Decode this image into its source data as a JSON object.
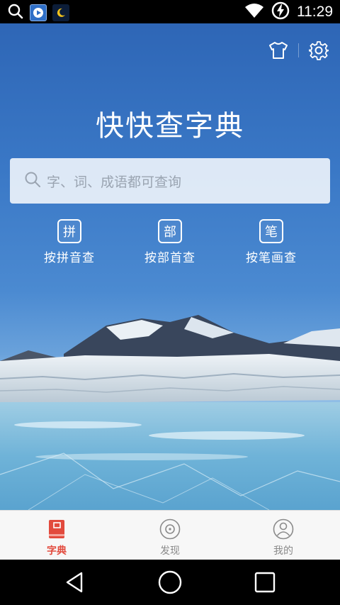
{
  "status_bar": {
    "time": "11:29",
    "left_icons": [
      "search-icon",
      "video-player-app-icon",
      "night-mode-app-icon"
    ],
    "right_icons": [
      "wifi-icon",
      "battery-charging-icon"
    ]
  },
  "header": {
    "app_title": "快快查字典",
    "icons": [
      "shirt-icon",
      "gear-icon"
    ]
  },
  "search": {
    "placeholder": "字、词、成语都可查询"
  },
  "lookup_modes": [
    {
      "badge": "拼",
      "label": "按拼音查"
    },
    {
      "badge": "部",
      "label": "按部首查"
    },
    {
      "badge": "笔",
      "label": "按笔画查"
    }
  ],
  "bottom_nav": {
    "tabs": [
      {
        "label": "字典",
        "icon": "dictionary-book-icon",
        "active": true
      },
      {
        "label": "发现",
        "icon": "discover-compass-icon",
        "active": false
      },
      {
        "label": "我的",
        "icon": "profile-icon",
        "active": false
      }
    ],
    "active_color": "#e24a3d",
    "inactive_color": "#8a8a8a"
  },
  "system_nav": [
    "back-icon",
    "home-icon",
    "recents-icon"
  ],
  "colors": {
    "sky_top": "#2e66b6",
    "search_bg": "#ecf2fa"
  }
}
